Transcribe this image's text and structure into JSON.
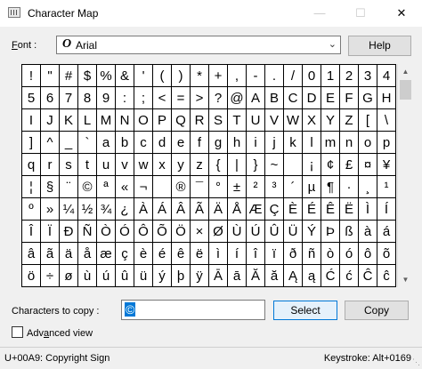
{
  "window": {
    "title": "Character Map",
    "minimize": "—",
    "maximize": "☐",
    "close": "✕"
  },
  "font": {
    "label_prefix": "",
    "label_underlined": "F",
    "label_rest": "ont :",
    "ttf_glyph": "O",
    "value": "Arial",
    "dropdown_icon": "chevron-down-icon"
  },
  "buttons": {
    "help": "Help",
    "select": "Select",
    "copy": "Copy"
  },
  "characters": [
    "!",
    "\"",
    "#",
    "$",
    "%",
    "&",
    "'",
    "(",
    ")",
    "*",
    "+",
    ",",
    "-",
    ".",
    "/",
    "0",
    "1",
    "2",
    "3",
    "4",
    "5",
    "6",
    "7",
    "8",
    "9",
    ":",
    ";",
    "<",
    "=",
    ">",
    "?",
    "@",
    "A",
    "B",
    "C",
    "D",
    "E",
    "F",
    "G",
    "H",
    "I",
    "J",
    "K",
    "L",
    "M",
    "N",
    "O",
    "P",
    "Q",
    "R",
    "S",
    "T",
    "U",
    "V",
    "W",
    "X",
    "Y",
    "Z",
    "[",
    "\\",
    "]",
    "^",
    "_",
    "`",
    "a",
    "b",
    "c",
    "d",
    "e",
    "f",
    "g",
    "h",
    "i",
    "j",
    "k",
    "l",
    "m",
    "n",
    "o",
    "p",
    "q",
    "r",
    "s",
    "t",
    "u",
    "v",
    "w",
    "x",
    "y",
    "z",
    "{",
    "|",
    "}",
    "~",
    " ",
    "¡",
    "¢",
    "£",
    "¤",
    "¥",
    "¦",
    "§",
    "¨",
    "©",
    "ª",
    "«",
    "¬",
    "­",
    "®",
    "¯",
    "°",
    "±",
    "²",
    "³",
    "´",
    "µ",
    "¶",
    "·",
    "¸",
    "¹",
    "º",
    "»",
    "¼",
    "½",
    "¾",
    "¿",
    "À",
    "Á",
    "Â",
    "Ã",
    "Ä",
    "Å",
    "Æ",
    "Ç",
    "È",
    "É",
    "Ê",
    "Ë",
    "Ì",
    "Í",
    "Î",
    "Ï",
    "Ð",
    "Ñ",
    "Ò",
    "Ó",
    "Ô",
    "Õ",
    "Ö",
    "×",
    "Ø",
    "Ù",
    "Ú",
    "Û",
    "Ü",
    "Ý",
    "Þ",
    "ß",
    "à",
    "á",
    "â",
    "ã",
    "ä",
    "å",
    "æ",
    "ç",
    "è",
    "é",
    "ê",
    "ë",
    "ì",
    "í",
    "î",
    "ï",
    "ð",
    "ñ",
    "ò",
    "ó",
    "ô",
    "õ",
    "ö",
    "÷",
    "ø",
    "ù",
    "ú",
    "û",
    "ü",
    "ý",
    "þ",
    "ÿ",
    "Ā",
    "ā",
    "Ă",
    "ă",
    "Ą",
    "ą",
    "Ć",
    "ć",
    "Ĉ",
    "ĉ"
  ],
  "copy": {
    "label": "Characters to copy :",
    "value": "©"
  },
  "advanced": {
    "label_prefix": "Adv",
    "label_underlined": "a",
    "label_rest": "nced view",
    "checked": false
  },
  "status": {
    "left": "U+00A9: Copyright Sign",
    "right": "Keystroke: Alt+0169"
  },
  "accent": "#0078d7"
}
